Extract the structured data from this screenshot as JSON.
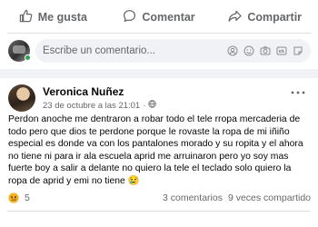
{
  "previous_post": {
    "actions": [
      {
        "label": "Me gusta",
        "icon": "like-icon"
      },
      {
        "label": "Comentar",
        "icon": "comment-icon"
      },
      {
        "label": "Compartir",
        "icon": "share-icon"
      }
    ],
    "comment_box": {
      "placeholder": "Escribe un comentario...",
      "icons": [
        "emoji-icon",
        "avatar-sticker-icon",
        "camera-icon",
        "gif-icon",
        "sticker-icon"
      ]
    }
  },
  "post": {
    "author": "Veronica Nuñez",
    "timestamp": "23 de octubre a las 21:01",
    "privacy_icon": "globe-icon",
    "text": "Perdon anoche me dentraron a robar todo el tele rropa mercaderia de todo pero que dios te perdone porque le rovaste la ropa de mi iñiño especial es donde va con los pantalones morado  y su ropita y el ahora no tiene ni para ir ala escuela aprid me arruinaron pero yo soy mas fuerte boy a salir a delante no quiero la tele  el teclado solo quiero la ropa de aprid y emi no tiene 😢",
    "reactions": {
      "icon": "sad-reaction-icon",
      "count": "5"
    },
    "comments": "3 comentarios",
    "shares": "9 veces compartido"
  },
  "colors": {
    "secondary_text": "#65676b",
    "online": "#31a24c",
    "sad_reaction": "#f7b125"
  }
}
